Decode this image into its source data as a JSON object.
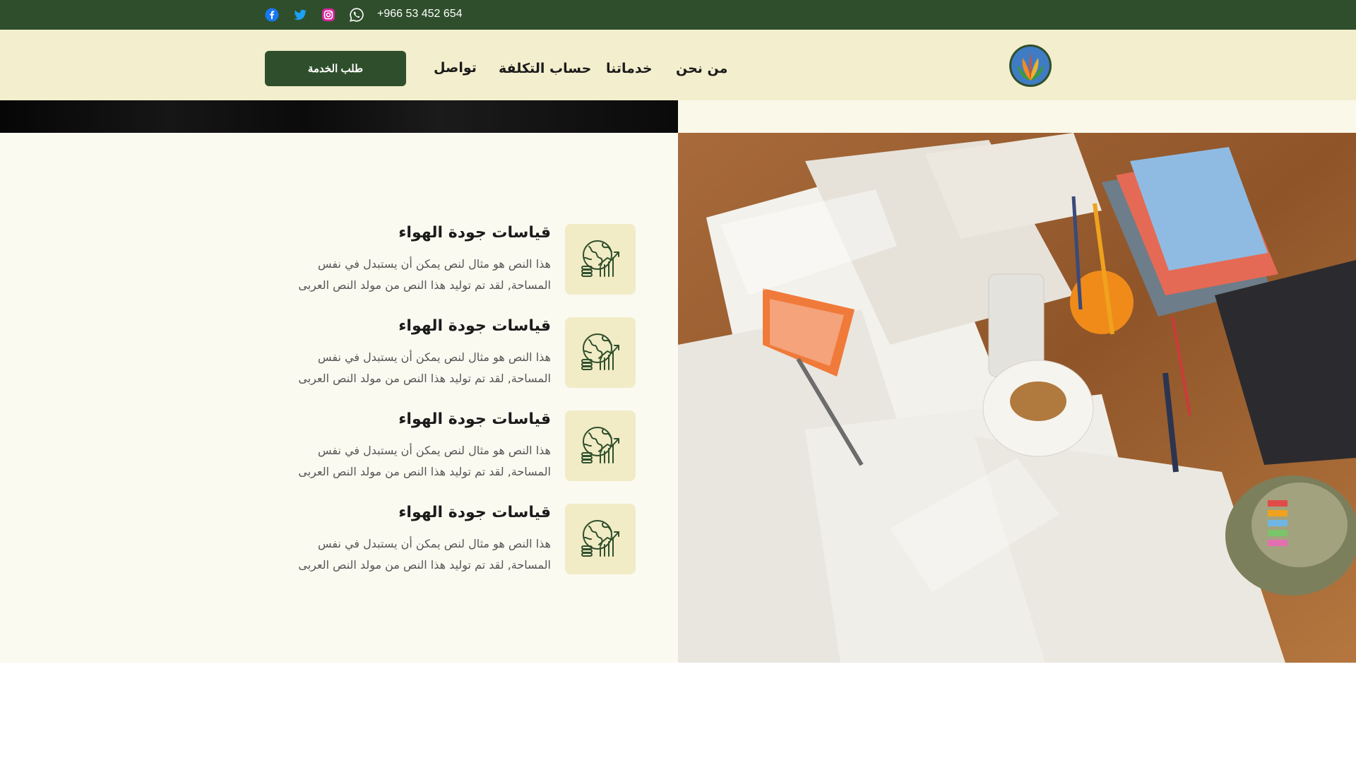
{
  "topbar": {
    "phone": "+966 53 452 654",
    "social": [
      "whatsapp-icon",
      "instagram-icon",
      "twitter-icon",
      "facebook-icon"
    ]
  },
  "header": {
    "cta_label": "طلب الخدمة",
    "nav": [
      "من نحن",
      "خدماتنا",
      "حساب التكلفة",
      "تواصل"
    ]
  },
  "features": [
    {
      "title": "قياسات جودة الهواء",
      "desc": "هذا النص هو مثال لنص يمكن أن يستبدل في نفس المساحة, لقد تم توليد هذا النص من مولد النص العربى"
    },
    {
      "title": "قياسات جودة الهواء",
      "desc": "هذا النص هو مثال لنص يمكن أن يستبدل في نفس المساحة, لقد تم توليد هذا النص من مولد النص العربى"
    },
    {
      "title": "قياسات جودة الهواء",
      "desc": "هذا النص هو مثال لنص يمكن أن يستبدل في نفس المساحة, لقد تم توليد هذا النص من مولد النص العربى"
    },
    {
      "title": "قياسات جودة الهواء",
      "desc": "هذا النص هو مثال لنص يمكن أن يستبدل في نفس المساحة, لقد تم توليد هذا النص من مولد النص العربى"
    }
  ],
  "colors": {
    "primary": "#2f4f2c",
    "header_bg": "#f3eecd",
    "panel_bg": "#fbfaf1",
    "icon_box_bg": "#f1ecc6"
  }
}
